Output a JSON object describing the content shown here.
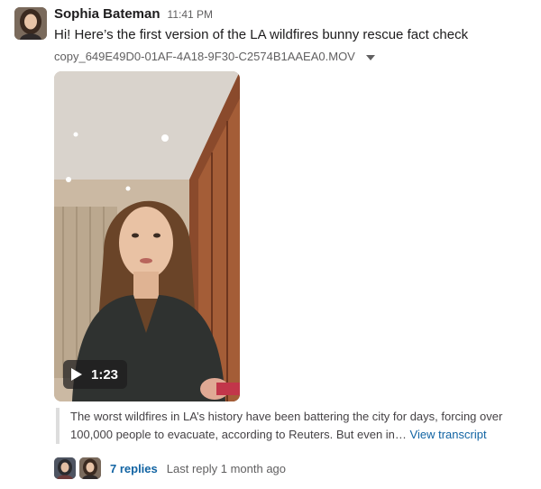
{
  "message": {
    "sender": "Sophia Bateman",
    "timestamp": "11:41 PM",
    "text": "Hi! Here’s the first version of the LA wildfires bunny rescue fact check"
  },
  "attachment": {
    "filename": "copy_649E49D0-01AF-4A18-9F30-C2574B1AAEA0.MOV",
    "duration": "1:23",
    "transcript_preview": "The worst wildfires in LA’s history have been battering the city for days, forcing over 100,000 people to evacuate, according to Reuters. But even in…",
    "view_transcript_label": "View transcript"
  },
  "thread": {
    "replies_label": "7 replies",
    "last_reply": "Last reply 1 month ago"
  },
  "icons": {
    "file_menu": "chevron-down-icon",
    "play": "play-icon"
  },
  "colors": {
    "link": "#1264a3",
    "text": "#1d1c1d",
    "muted": "#616061"
  }
}
